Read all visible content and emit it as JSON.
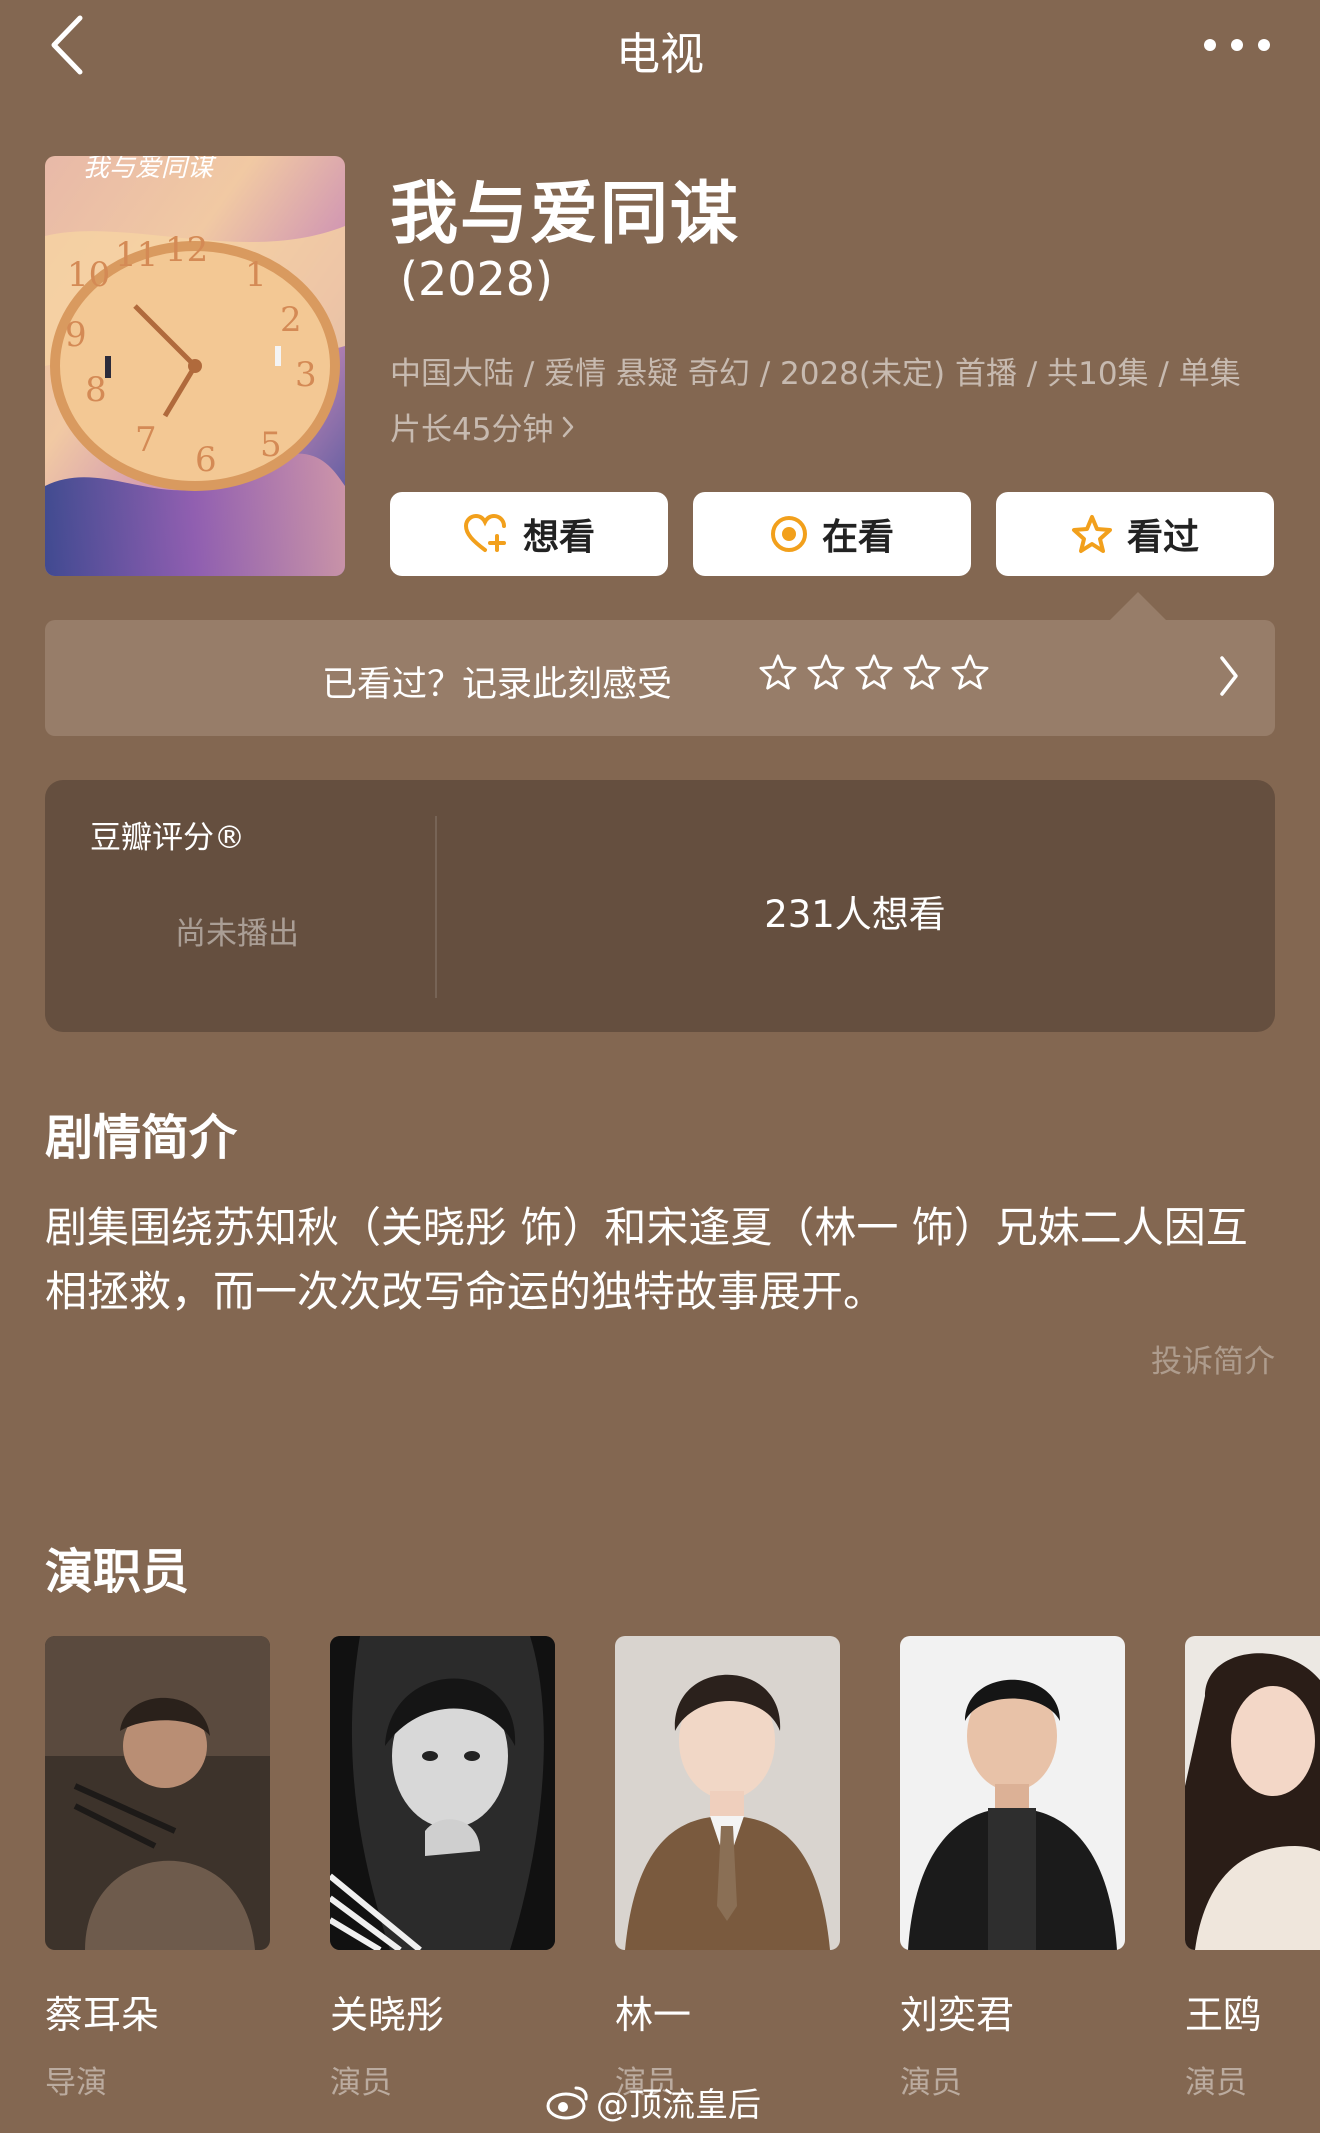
{
  "header": {
    "title": "电视"
  },
  "show": {
    "title": "我与爱同谋",
    "year": "(2028)",
    "meta_line1": "中国大陆 / 爱情 悬疑 奇幻 / 2028(未定) 首播 / 共10集 / 单集",
    "meta_line2": "片长45分钟",
    "poster_title_art": "我与爱同谋"
  },
  "actions": {
    "want": "想看",
    "watching": "在看",
    "watched": "看过"
  },
  "rating_prompt": {
    "text": "已看过？记录此刻感受",
    "stars": 5
  },
  "score": {
    "label": "豆瓣评分®",
    "status": "尚未播出",
    "want_count": "231人想看"
  },
  "synopsis": {
    "heading": "剧情简介",
    "text": "剧集围绕苏知秋（关晓彤 饰）和宋逢夏（林一 饰）兄妹二人因互相拯救，而一次次改写命运的独特故事展开。",
    "report": "投诉简介"
  },
  "cast": {
    "heading": "演职员",
    "members": [
      {
        "name": "蔡耳朵",
        "role": "导演"
      },
      {
        "name": "关晓彤",
        "role": "演员"
      },
      {
        "name": "林一",
        "role": "演员"
      },
      {
        "name": "刘奕君",
        "role": "演员"
      },
      {
        "name": "王鸥",
        "role": "演员"
      }
    ]
  },
  "watermark": "@顶流皇后",
  "colors": {
    "background": "#836751",
    "score_card": "#654f3f",
    "rate_bar": "#977d69",
    "accent_orange": "#f2a01c"
  }
}
